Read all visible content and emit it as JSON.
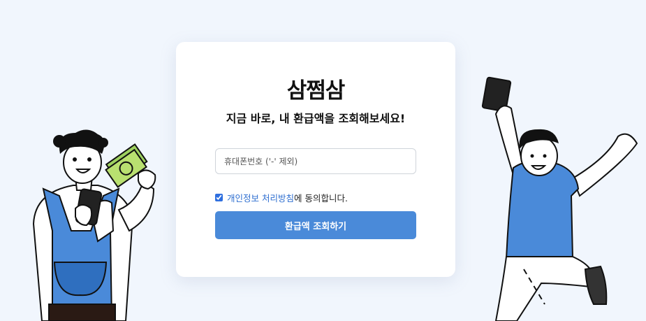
{
  "brand": {
    "logo_text": "삼쩜삼"
  },
  "form": {
    "headline": "지금 바로, 내 환급액을 조회해보세요!",
    "phone_placeholder": "휴대폰번호 ('-' 제외)",
    "consent_link": "개인정보 처리방침",
    "consent_suffix": "에 동의합니다.",
    "consent_checked": true,
    "submit_label": "환급액 조회하기"
  },
  "colors": {
    "background": "#f1f6fd",
    "accent": "#4a8ad9",
    "link": "#2f6fd0"
  },
  "illustrations": {
    "left": "person-holding-money-and-phone-icon",
    "right": "person-jumping-with-phone-icon"
  }
}
